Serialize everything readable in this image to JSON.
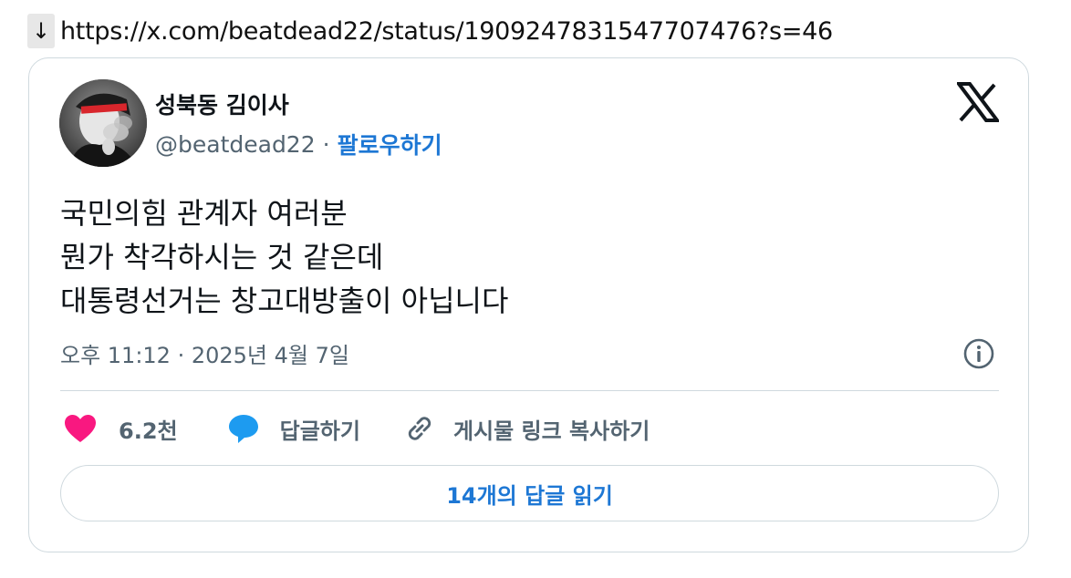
{
  "url_bar": {
    "arrow": "↓",
    "url": "https://x.com/beatdead22/status/1909247831547707476?s=46"
  },
  "author": {
    "display_name": "성북동 김이사",
    "handle": "@beatdead22",
    "separator": "·",
    "follow_label": "팔로우하기"
  },
  "tweet": {
    "lines": [
      "국민의힘 관계자 여러분",
      "뭔가 착각하시는 것 같은데",
      "대통령선거는 창고대방출이 아닙니다"
    ],
    "timestamp": "오후 11:12 · 2025년 4월 7일"
  },
  "actions": {
    "like_count": "6.2천",
    "reply_label": "답글하기",
    "copy_link_label": "게시물 링크 복사하기"
  },
  "read_replies_label": "14개의 답글 읽기",
  "colors": {
    "link_blue": "#1d77d4",
    "like_pink": "#f91880",
    "reply_blue": "#1d9bf0",
    "muted_text": "#536471",
    "border": "#cfd9de"
  },
  "icons": [
    "down-arrow-icon",
    "x-logo-icon",
    "info-icon",
    "heart-icon",
    "speech-bubble-icon",
    "link-icon"
  ]
}
